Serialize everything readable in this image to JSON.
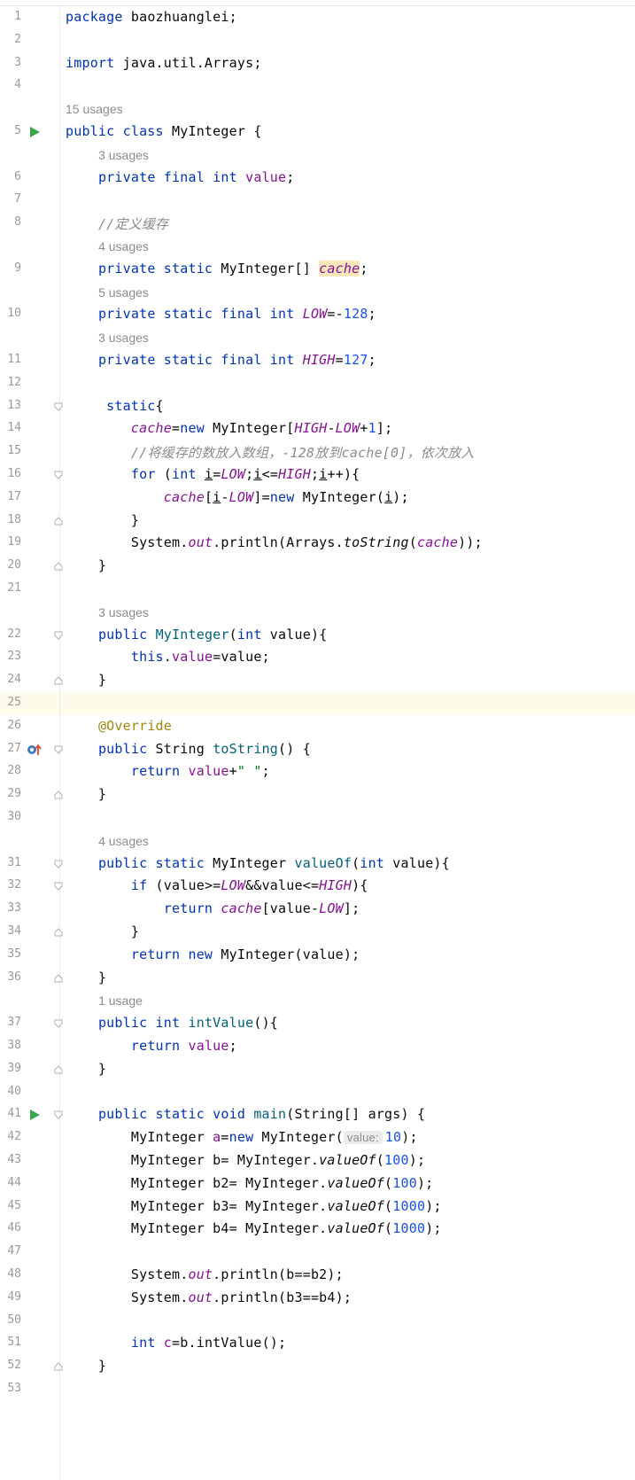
{
  "editor": {
    "lines": [
      {
        "num": "1",
        "html": "<span class='kw'>package</span> baozhuanglei;"
      },
      {
        "num": "2",
        "html": ""
      },
      {
        "num": "3",
        "html": "<span class='kw'>import</span> java.util.Arrays;"
      },
      {
        "num": "4",
        "html": ""
      },
      {
        "usage": "15 usages",
        "indent": 0
      },
      {
        "num": "5",
        "html": "<span class='kw'>public class</span> MyInteger {",
        "run": true
      },
      {
        "usage": "3 usages",
        "indent": 1
      },
      {
        "num": "6",
        "html": "    <span class='kw'>private final int</span> <span class='fld'>value</span>;"
      },
      {
        "num": "7",
        "html": ""
      },
      {
        "num": "8",
        "html": "    <span class='cmt'>//定义缓存</span>"
      },
      {
        "usage": "4 usages",
        "indent": 1
      },
      {
        "num": "9",
        "html": "    <span class='kw'>private static</span> MyInteger[] <span class='sfld cachehl'>cache</span>;"
      },
      {
        "usage": "5 usages",
        "indent": 1
      },
      {
        "num": "10",
        "html": "    <span class='kw'>private static final int</span> <span class='sfld'>LOW</span>=-<span class='num'>128</span>;"
      },
      {
        "usage": "3 usages",
        "indent": 1
      },
      {
        "num": "11",
        "html": "    <span class='kw'>private static final int</span> <span class='sfld'>HIGH</span>=<span class='num'>127</span>;"
      },
      {
        "num": "12",
        "html": ""
      },
      {
        "num": "13",
        "html": "     <span class='kw'>static</span>{",
        "fold": "open"
      },
      {
        "num": "14",
        "html": "        <span class='sfld'>cache</span>=<span class='kw'>new</span> MyInteger[<span class='sfld'>HIGH</span>-<span class='sfld'>LOW</span>+<span class='num'>1</span>];"
      },
      {
        "num": "15",
        "html": "        <span class='cmt'>//将缓存的数放入数组，-128放到cache[0]，依次放入</span>"
      },
      {
        "num": "16",
        "html": "        <span class='kw'>for</span> (<span class='kw'>int</span> <span class='under'>i</span>=<span class='sfld'>LOW</span>;<span class='under'>i</span>&lt;=<span class='sfld'>HIGH</span>;<span class='under'>i</span>++){",
        "fold": "open"
      },
      {
        "num": "17",
        "html": "            <span class='sfld'>cache</span>[<span class='under'>i</span>-<span class='sfld'>LOW</span>]=<span class='kw'>new</span> MyInteger(<span class='under'>i</span>);"
      },
      {
        "num": "18",
        "html": "        }",
        "fold": "close"
      },
      {
        "num": "19",
        "html": "        System.<span class='sfld'>out</span>.println(Arrays.<span class='ital'>toString</span>(<span class='sfld'>cache</span>));"
      },
      {
        "num": "20",
        "html": "    }",
        "fold": "close"
      },
      {
        "num": "21",
        "html": ""
      },
      {
        "usage": "3 usages",
        "indent": 1
      },
      {
        "num": "22",
        "html": "    <span class='kw'>public</span> <span class='mdecl'>MyInteger</span>(<span class='kw'>int</span> value){",
        "fold": "open"
      },
      {
        "num": "23",
        "html": "        <span class='kw'>this</span>.<span class='fld'>value</span>=value;"
      },
      {
        "num": "24",
        "html": "    }",
        "fold": "close"
      },
      {
        "num": "25",
        "html": "",
        "highlight": true
      },
      {
        "num": "26",
        "html": "    <span class='ann'>@Override</span>"
      },
      {
        "num": "27",
        "html": "    <span class='kw'>public</span> String <span class='mdecl'>toString</span>() {",
        "fold": "open",
        "override": true
      },
      {
        "num": "28",
        "html": "        <span class='kw'>return</span> <span class='fld'>value</span>+<span class='str'>\" \"</span>;"
      },
      {
        "num": "29",
        "html": "    }",
        "fold": "close"
      },
      {
        "num": "30",
        "html": ""
      },
      {
        "usage": "4 usages",
        "indent": 1
      },
      {
        "num": "31",
        "html": "    <span class='kw'>public static</span> MyInteger <span class='mdecl'>valueOf</span>(<span class='kw'>int</span> value){",
        "fold": "open"
      },
      {
        "num": "32",
        "html": "        <span class='kw'>if</span> (value&gt;=<span class='sfld'>LOW</span>&amp;&amp;value&lt;=<span class='sfld'>HIGH</span>){",
        "fold": "open"
      },
      {
        "num": "33",
        "html": "            <span class='kw'>return</span> <span class='sfld'>cache</span>[value-<span class='sfld'>LOW</span>];"
      },
      {
        "num": "34",
        "html": "        }",
        "fold": "close"
      },
      {
        "num": "35",
        "html": "        <span class='kw'>return new</span> MyInteger(value);"
      },
      {
        "num": "36",
        "html": "    }",
        "fold": "close"
      },
      {
        "usage": "1 usage",
        "indent": 1
      },
      {
        "num": "37",
        "html": "    <span class='kw'>public int</span> <span class='mdecl'>intValue</span>(){",
        "fold": "open"
      },
      {
        "num": "38",
        "html": "        <span class='kw'>return</span> <span class='fld'>value</span>;"
      },
      {
        "num": "39",
        "html": "    }",
        "fold": "close"
      },
      {
        "num": "40",
        "html": ""
      },
      {
        "num": "41",
        "html": "    <span class='kw'>public static void</span> <span class='mdecl'>main</span>(String[] args) {",
        "fold": "open",
        "run": true
      },
      {
        "num": "42",
        "html": "        MyInteger <span class='fld'>a</span>=<span class='kw'>new</span> MyInteger(<span class='hint'>value:</span><span class='num'>10</span>);"
      },
      {
        "num": "43",
        "html": "        MyInteger b= MyInteger.<span class='ital'>valueOf</span>(<span class='num'>100</span>);"
      },
      {
        "num": "44",
        "html": "        MyInteger b2= MyInteger.<span class='ital'>valueOf</span>(<span class='num'>100</span>);"
      },
      {
        "num": "45",
        "html": "        MyInteger b3= MyInteger.<span class='ital'>valueOf</span>(<span class='num'>1000</span>);"
      },
      {
        "num": "46",
        "html": "        MyInteger b4= MyInteger.<span class='ital'>valueOf</span>(<span class='num'>1000</span>);"
      },
      {
        "num": "47",
        "html": ""
      },
      {
        "num": "48",
        "html": "        System.<span class='sfld'>out</span>.println(b==b2);"
      },
      {
        "num": "49",
        "html": "        System.<span class='sfld'>out</span>.println(b3==b4);"
      },
      {
        "num": "50",
        "html": ""
      },
      {
        "num": "51",
        "html": "        <span class='kw'>int</span> <span class='fld'>c</span>=b.intValue();"
      },
      {
        "num": "52",
        "html": "    }",
        "fold": "close"
      },
      {
        "num": "53",
        "html": ""
      }
    ]
  }
}
